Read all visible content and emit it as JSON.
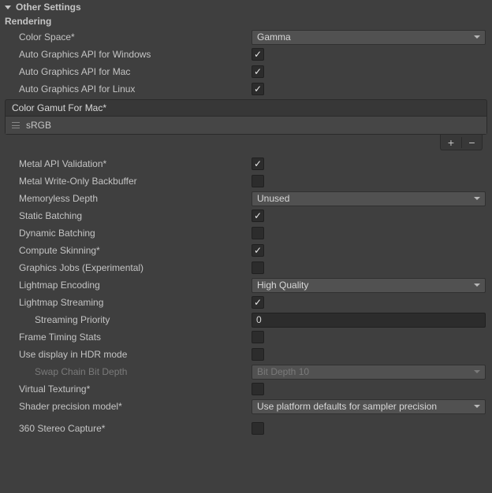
{
  "header": {
    "title": "Other Settings"
  },
  "section": {
    "rendering": "Rendering"
  },
  "rows": {
    "colorSpace": {
      "label": "Color Space*",
      "value": "Gamma"
    },
    "autoWin": {
      "label": "Auto Graphics API  for Windows",
      "checked": true
    },
    "autoMac": {
      "label": "Auto Graphics API  for Mac",
      "checked": true
    },
    "autoLinux": {
      "label": "Auto Graphics API  for Linux",
      "checked": true
    },
    "colorGamut": {
      "header": "Color Gamut For Mac*",
      "item": "sRGB"
    },
    "metalValidation": {
      "label": "Metal API Validation*",
      "checked": true
    },
    "metalWriteOnly": {
      "label": "Metal Write-Only Backbuffer",
      "checked": false
    },
    "memorylessDepth": {
      "label": "Memoryless Depth",
      "value": "Unused"
    },
    "staticBatching": {
      "label": "Static Batching",
      "checked": true
    },
    "dynamicBatching": {
      "label": "Dynamic Batching",
      "checked": false
    },
    "computeSkinning": {
      "label": "Compute Skinning*",
      "checked": true
    },
    "graphicsJobs": {
      "label": "Graphics Jobs (Experimental)",
      "checked": false
    },
    "lightmapEncoding": {
      "label": "Lightmap Encoding",
      "value": "High Quality"
    },
    "lightmapStreaming": {
      "label": "Lightmap Streaming",
      "checked": true
    },
    "streamingPriority": {
      "label": "Streaming Priority",
      "value": "0"
    },
    "frameTiming": {
      "label": "Frame Timing Stats",
      "checked": false
    },
    "hdrMode": {
      "label": "Use display in HDR mode",
      "checked": false
    },
    "swapChain": {
      "label": "Swap Chain Bit Depth",
      "value": "Bit Depth 10"
    },
    "virtualTexturing": {
      "label": "Virtual Texturing*",
      "checked": false
    },
    "shaderPrecision": {
      "label": "Shader precision model*",
      "value": "Use platform defaults for sampler precision"
    },
    "stereo360": {
      "label": "360 Stereo Capture*",
      "checked": false
    }
  },
  "buttons": {
    "add": "+",
    "remove": "−"
  }
}
